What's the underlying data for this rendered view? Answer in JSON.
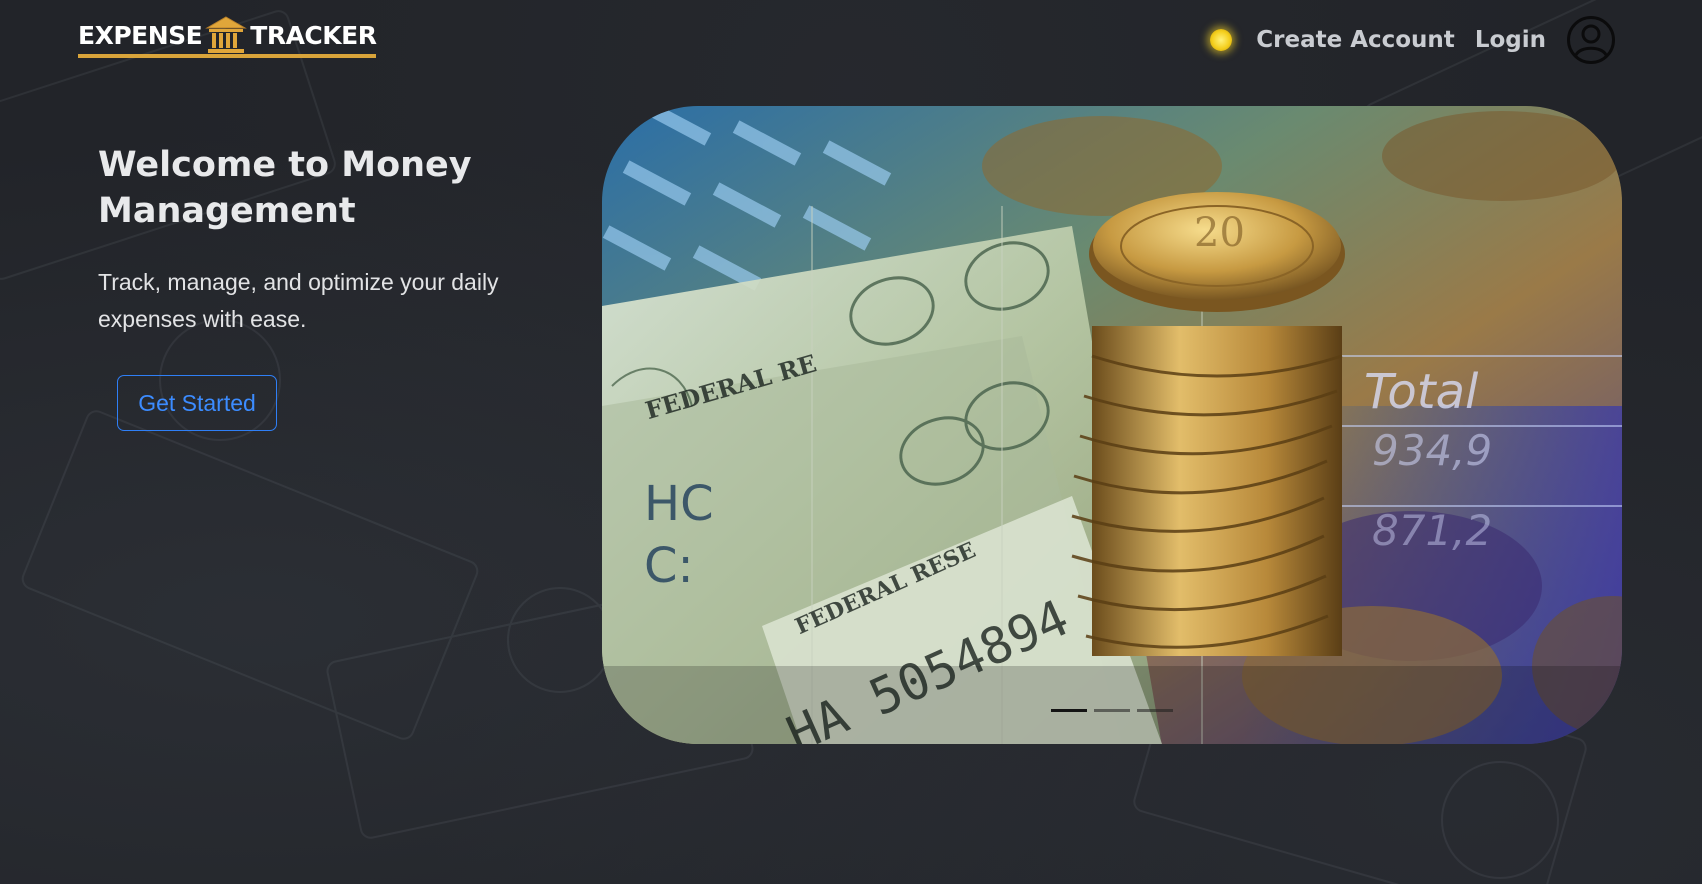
{
  "brand": {
    "left_word": "EXPENSE",
    "right_word": "TRACKER",
    "accent_color": "#d9a43a",
    "logo_icon": "bank-building-icon"
  },
  "nav": {
    "theme_toggle_icon": "sun-icon",
    "create_account": "Create Account",
    "login": "Login",
    "profile_icon": "user-circle-icon"
  },
  "hero": {
    "title": "Welcome to Money Management",
    "subtitle": "Track, manage, and optimize your daily expenses with ease.",
    "cta_label": "Get Started",
    "cta_color": "#2f7ff6"
  },
  "carousel": {
    "slide_count": 3,
    "active_index": 0,
    "image_text": {
      "federal_1": "FEDERAL RE",
      "federal_2": "FEDERAL RESE",
      "serial": "HA 5054894",
      "left_code": "HC",
      "left_code_2": "C:",
      "total_label": "Total",
      "total_value": "934,9",
      "total_value_2": "871,2",
      "coin_value": "20"
    }
  }
}
